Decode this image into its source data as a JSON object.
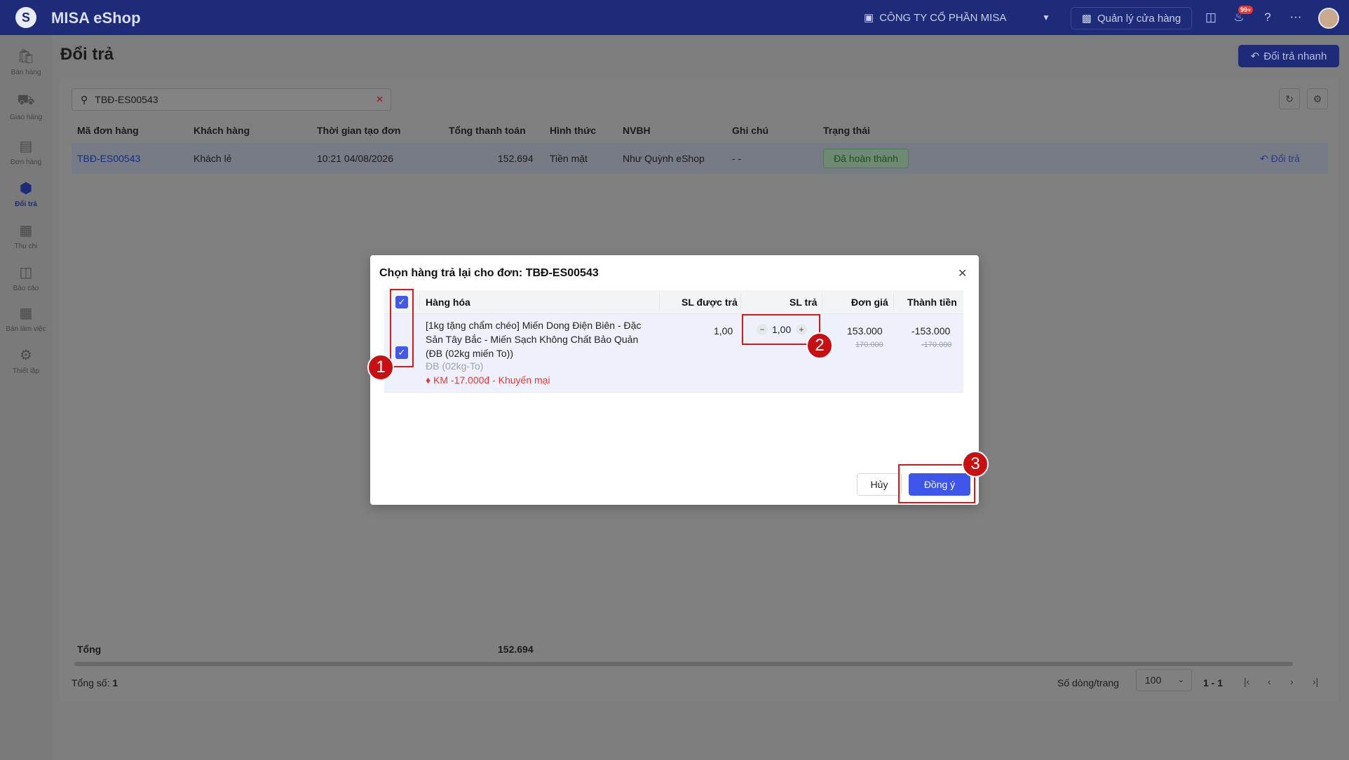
{
  "app": {
    "name": "MISA eShop",
    "logo": "S"
  },
  "topbar": {
    "company": "CÔNG TY CỔ PHẦN MISA",
    "store_button": "Quản lý cửa hàng",
    "notification_badge": "99+"
  },
  "sidebar": {
    "items": [
      {
        "label": "Bán hàng",
        "icon": "shopping-bag-icon"
      },
      {
        "label": "Giao hàng",
        "icon": "truck-icon"
      },
      {
        "label": "Đơn hàng",
        "icon": "clipboard-icon"
      },
      {
        "label": "Đổi trả",
        "icon": "return-box-icon",
        "active": true
      },
      {
        "label": "Thu chi",
        "icon": "cash-icon"
      },
      {
        "label": "Báo cáo",
        "icon": "chart-icon"
      },
      {
        "label": "Bàn làm việc",
        "icon": "grid-icon"
      },
      {
        "label": "Thiết lập",
        "icon": "gear-icon"
      }
    ]
  },
  "page": {
    "title": "Đổi trả",
    "quick_return_button": "Đổi trả nhanh",
    "search_value": "TBĐ-ES00543"
  },
  "table": {
    "columns": [
      "Mã đơn hàng",
      "Khách hàng",
      "Thời gian tạo đơn",
      "Tổng thanh toán",
      "Hình thức",
      "NVBH",
      "Ghi chú",
      "Trạng thái"
    ],
    "rows": [
      {
        "order_code": "TBĐ-ES00543",
        "customer": "Khách lẻ",
        "created": "10:21 04/08/2026",
        "total": "152.694",
        "method": "Tiền mặt",
        "staff": "Như Quỳnh eShop",
        "note": "- -",
        "status": "Đã hoàn thành",
        "action": "Đổi trả"
      }
    ],
    "footer": {
      "label": "Tổng",
      "total": "152.694"
    }
  },
  "pagination": {
    "count_label": "Tổng số:",
    "count": "1",
    "rows_per_page_label": "Số dòng/trang",
    "rows_per_page": "100",
    "range": "1 - 1"
  },
  "modal": {
    "title": "Chọn hàng trả lại cho đơn: TBĐ-ES00543",
    "columns": {
      "product": "Hàng hóa",
      "returnable_qty": "SL được trả",
      "return_qty": "SL trả",
      "unit_price": "Đơn giá",
      "amount": "Thành tiền"
    },
    "item": {
      "name": "[1kg tặng chẩm chéo] Miến Dong Điện Biên - Đặc Sản Tây Bắc - Miến Sạch Không Chất Bảo Quản (ĐB (02kg miến To))",
      "variant": "ĐB (02kg-To)",
      "promo": "KM -17.000đ - Khuyến mại",
      "returnable_qty": "1,00",
      "return_qty": "1,00",
      "unit_price": "153.000",
      "unit_price_original": "170.000",
      "amount": "-153.000",
      "amount_original": "-170.000"
    },
    "cancel_button": "Hủy",
    "confirm_button": "Đồng ý"
  },
  "annotations": [
    "1",
    "2",
    "3"
  ],
  "colors": {
    "brand": "#1d2b78",
    "primary": "#3d55e8",
    "highlight": "#d7191c",
    "promo": "#e53935"
  }
}
